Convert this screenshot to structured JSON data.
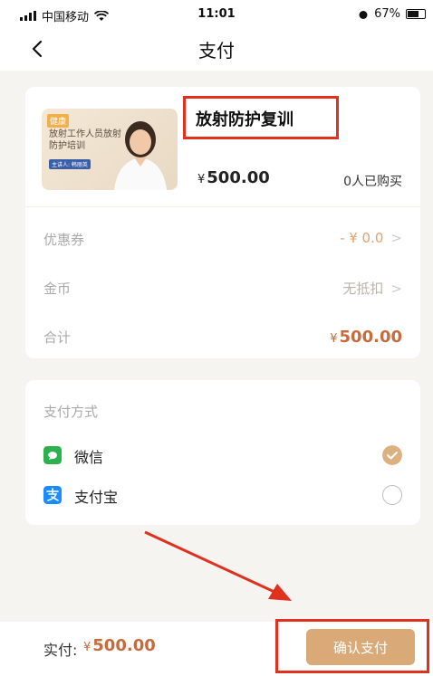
{
  "status_bar": {
    "carrier": "中国移动",
    "time": "11:01",
    "battery": "67%"
  },
  "nav": {
    "title": "支付",
    "back_icon": "chevron-left-icon"
  },
  "product": {
    "thumbnail": {
      "tag": "健康",
      "title": "放射工作人员放射防护培训",
      "host": "主讲人: 韩丽英"
    },
    "title": "放射防护复训",
    "price_symbol": "¥",
    "price": "500.00",
    "buyers": "0人已购买"
  },
  "rows": {
    "coupon_label": "优惠券",
    "coupon_value": "- ¥ 0.0",
    "coins_label": "金币",
    "coins_value": "无抵扣",
    "total_label": "合计",
    "total_symbol": "¥",
    "total_value": "500.00",
    "chevron": ">"
  },
  "payment": {
    "heading": "支付方式",
    "options": [
      {
        "label": "微信",
        "icon": "wechat-icon",
        "selected": true
      },
      {
        "label": "支付宝",
        "icon": "alipay-icon",
        "selected": false
      }
    ]
  },
  "bottom": {
    "actual_label": "实付:",
    "actual_symbol": "¥",
    "actual_amount": "500.00",
    "confirm_label": "确认支付"
  },
  "colors": {
    "accent": "#d9a978",
    "price_accent": "#c86b3c",
    "highlight": "#e0301e",
    "wechat": "#2bb24c",
    "alipay": "#1a8cff"
  }
}
